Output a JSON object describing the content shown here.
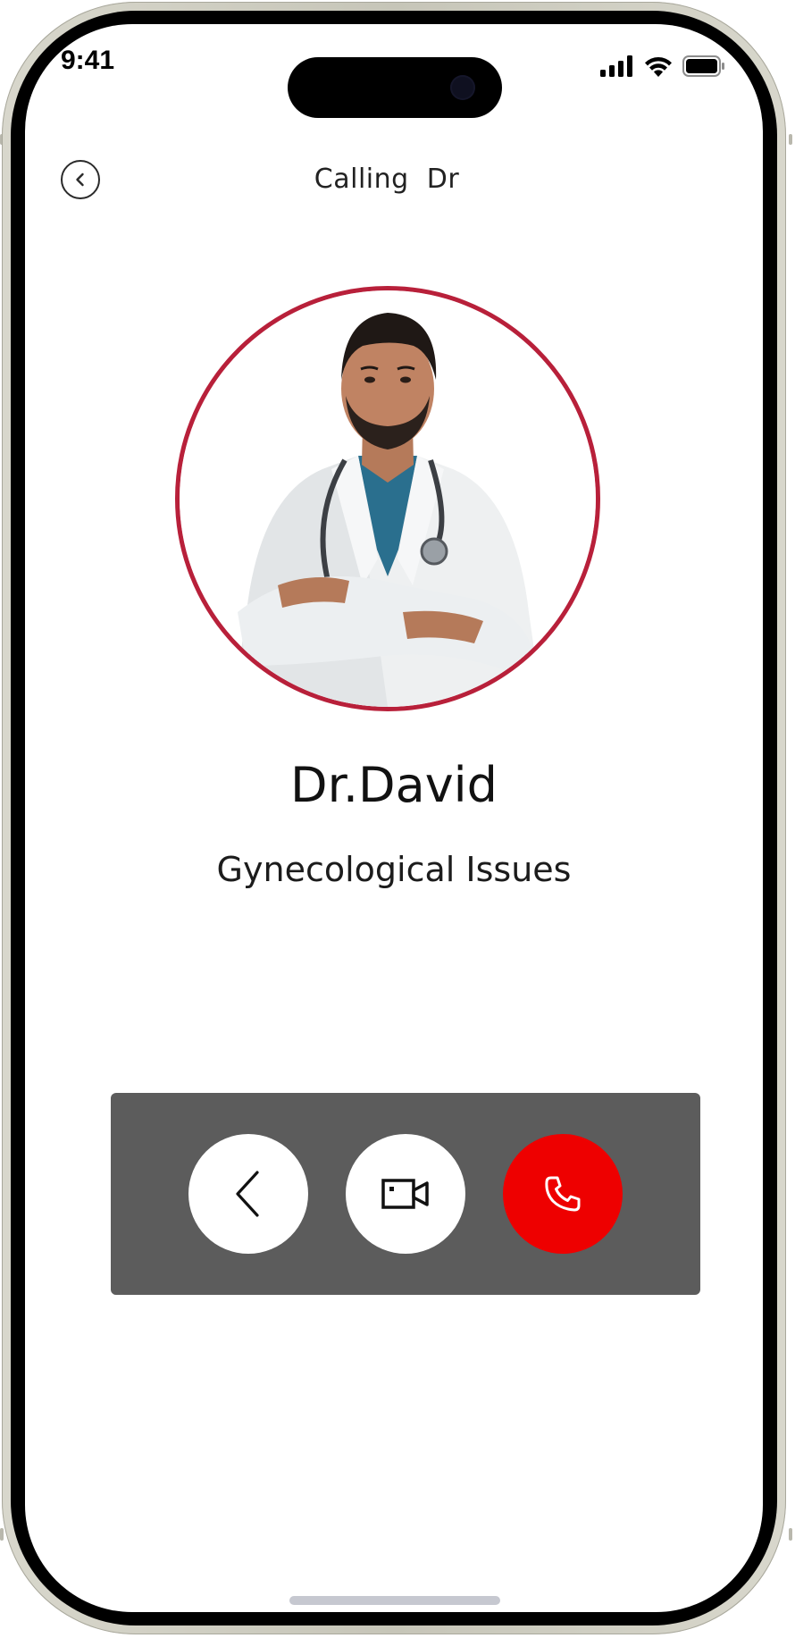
{
  "status_bar": {
    "time": "9:41",
    "signal_icon": "cellular-signal-icon",
    "wifi_icon": "wifi-icon",
    "battery_icon": "battery-icon"
  },
  "header": {
    "title": "Calling  Dr",
    "back_icon": "back-chevron-circle-icon"
  },
  "doctor": {
    "name": "Dr.David",
    "specialty": "Gynecological Issues",
    "photo_description_icon": "doctor-photo"
  },
  "controls": {
    "back_icon": "chevron-left-icon",
    "video_icon": "video-camera-icon",
    "end_call_icon": "phone-hangup-icon"
  },
  "colors": {
    "avatar_ring": "#b8203a",
    "controls_panel": "#5c5c5c",
    "end_call": "#ee0000",
    "text": "#111111"
  }
}
